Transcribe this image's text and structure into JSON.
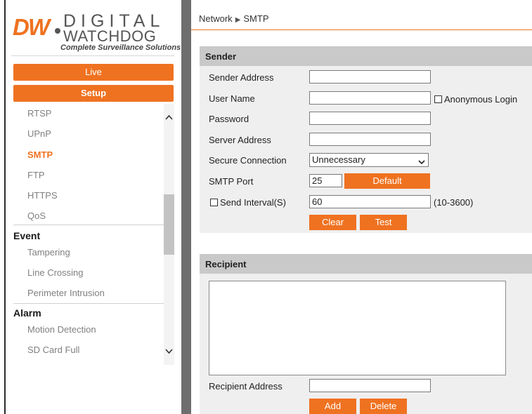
{
  "brand": {
    "logo_mark": "DW",
    "logo_line1": "DIGITAL",
    "logo_line2": "WATCHDOG",
    "tagline": "Complete Surveillance Solutions",
    "accent_color": "#ef7221"
  },
  "nav": {
    "live_label": "Live",
    "setup_label": "Setup"
  },
  "menu": {
    "network_items": [
      "RTSP",
      "UPnP",
      "SMTP",
      "FTP",
      "HTTPS",
      "QoS"
    ],
    "active_item": "SMTP",
    "event_header": "Event",
    "event_items": [
      "Tampering",
      "Line Crossing",
      "Perimeter Intrusion"
    ],
    "alarm_header": "Alarm",
    "alarm_items": [
      "Motion Detection",
      "SD Card Full"
    ]
  },
  "breadcrumb": {
    "parent": "Network",
    "current": "SMTP"
  },
  "sender": {
    "header": "Sender",
    "sender_address_label": "Sender Address",
    "sender_address_value": "",
    "user_name_label": "User Name",
    "user_name_value": "",
    "anonymous_login_label": "Anonymous Login",
    "anonymous_login_checked": false,
    "password_label": "Password",
    "password_value": "",
    "server_address_label": "Server Address",
    "server_address_value": "",
    "secure_connection_label": "Secure Connection",
    "secure_connection_value": "Unnecessary",
    "smtp_port_label": "SMTP Port",
    "smtp_port_value": "25",
    "default_button": "Default",
    "send_interval_label": "Send Interval(S)",
    "send_interval_checked": false,
    "send_interval_value": "60",
    "send_interval_range": "(10-3600)",
    "clear_button": "Clear",
    "test_button": "Test"
  },
  "recipient": {
    "header": "Recipient",
    "recipient_address_label": "Recipient Address",
    "recipient_address_value": "",
    "add_button": "Add",
    "delete_button": "Delete"
  }
}
